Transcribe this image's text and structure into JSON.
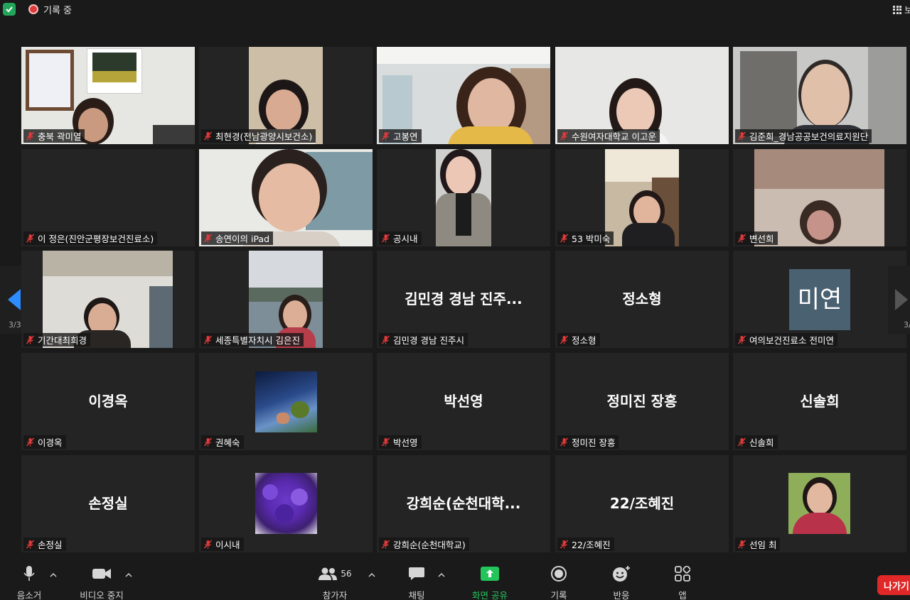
{
  "topbar": {
    "recording_label": "기록 중",
    "view_label": "보"
  },
  "pagination": {
    "left": "3/3",
    "right": "3/"
  },
  "tiles": [
    {
      "name": "충북 곽미열",
      "type": "video"
    },
    {
      "name": "최현경(전남광양시보건소)",
      "type": "video"
    },
    {
      "name": "고봉연",
      "type": "video"
    },
    {
      "name": "수원여자대학교 이고운",
      "type": "video"
    },
    {
      "name": "김준희_경남공공보건의료지원단",
      "type": "video"
    },
    {
      "name": "이 정은(진안군평장보건진료소)",
      "type": "blank"
    },
    {
      "name": "송연이의 iPad",
      "type": "video"
    },
    {
      "name": "공시내",
      "type": "video"
    },
    {
      "name": "53 박미숙",
      "type": "video"
    },
    {
      "name": "변선희",
      "type": "video"
    },
    {
      "name": "기간대최희경",
      "type": "video"
    },
    {
      "name": "세종특별자치시 김은진",
      "type": "video"
    },
    {
      "name": "김민경 경남 진주시",
      "type": "text",
      "display": "김민경 경남 진주..."
    },
    {
      "name": "정소형",
      "type": "text",
      "display": "정소형"
    },
    {
      "name": "여의보건진료소 전미연",
      "type": "avatar",
      "display": "미연"
    },
    {
      "name": "이경옥",
      "type": "text",
      "display": "이경옥"
    },
    {
      "name": "권혜숙",
      "type": "picture"
    },
    {
      "name": "박선영",
      "type": "text",
      "display": "박선영"
    },
    {
      "name": "정미진 장흥",
      "type": "text",
      "display": "정미진 장흥"
    },
    {
      "name": "신솔희",
      "type": "text",
      "display": "신솔희"
    },
    {
      "name": "손정실",
      "type": "text",
      "display": "손정실"
    },
    {
      "name": "이시내",
      "type": "picture"
    },
    {
      "name": "강희순(순천대학교)",
      "type": "text",
      "display": "강희순(순천대학..."
    },
    {
      "name": "22/조혜진",
      "type": "text",
      "display": "22/조혜진"
    },
    {
      "name": "선임 최",
      "type": "picture"
    }
  ],
  "toolbar": {
    "mute": "음소거",
    "video": "비디오 중지",
    "participants": "참가자",
    "participants_count": "56",
    "chat": "채팅",
    "share": "화면 공유",
    "record": "기록",
    "reactions": "반응",
    "apps": "앱",
    "leave": "나가기"
  },
  "colors": {
    "share_green": "#23c45a",
    "leave_red": "#e02828",
    "nav_blue": "#2d8cff",
    "mic_off_red": "#e03a3a"
  }
}
